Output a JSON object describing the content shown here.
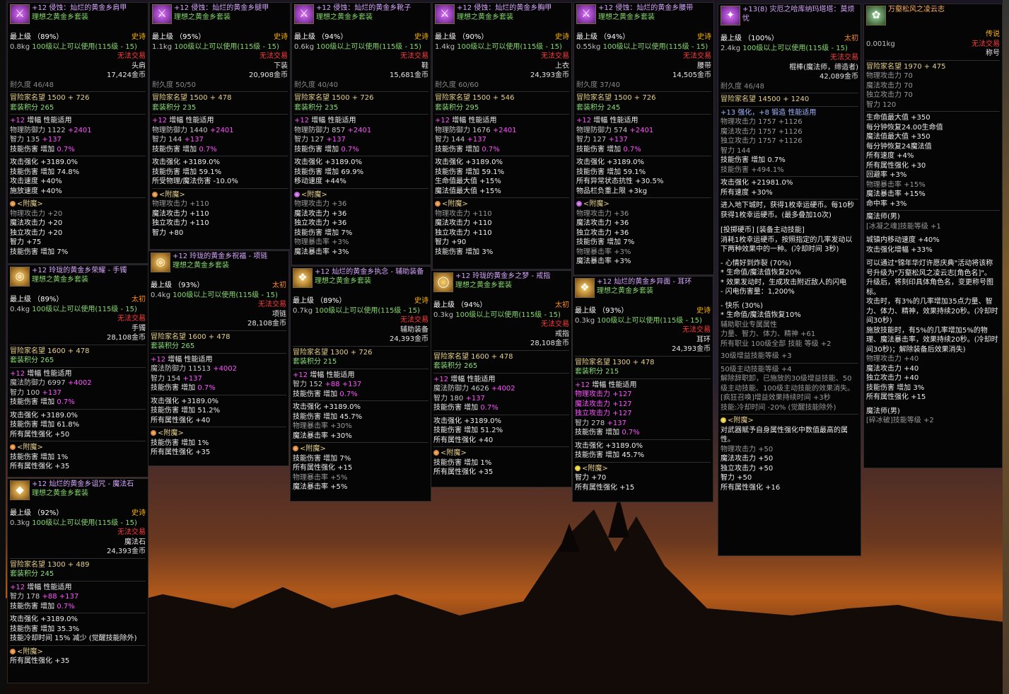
{
  "tooltips": [
    {
      "id": "shoulder",
      "title": "+12 侵蚀：灿烂的黄金乡肩甲",
      "set": "理想之黄金乡套装",
      "grade": "最上级 （89%）",
      "rarity": "史诗",
      "weight": "0.8kg",
      "level": "100级以上可以使用(115级 - 15)",
      "trade": "无法交易",
      "slot": "头肩",
      "price": "17,424金币",
      "durability": "耐久度 46/48",
      "renown": "冒险家名望 1500 + 726",
      "setpoints": "套装积分 265",
      "amp_line": "增幅 性能适用",
      "amp_prefix": "+12",
      "stats": [
        {
          "t": "物理防御力 1122",
          "b": "+2401"
        },
        {
          "t": "智力 135",
          "b": "+137"
        },
        {
          "t": "技能伤害 增加",
          "b": "0.7%"
        }
      ],
      "options": [
        "攻击强化 +3189.0%",
        "技能伤害 增加 74.8%",
        "攻击速度 +40%",
        "施放速度 +40%"
      ],
      "enchant_label": "<附魔>",
      "enchant_dim": "物理攻击力 +20",
      "enchant": [
        "魔法攻击力 +20",
        "独立攻击力 +20",
        "智力 +75",
        "技能伤害 增加 7%"
      ]
    },
    {
      "id": "pants",
      "title": "+12 侵蚀：灿烂的黄金乡腿甲",
      "set": "理想之黄金乡套装",
      "grade": "最上级 （95%）",
      "rarity": "史诗",
      "weight": "1.1kg",
      "level": "100级以上可以使用(115级 - 15)",
      "trade": "无法交易",
      "slot": "下装",
      "price": "20,908金币",
      "durability": "耐久度 50/50",
      "renown": "冒险家名望 1500 + 478",
      "setpoints": "套装积分 235",
      "amp_line": "增幅 性能适用",
      "amp_prefix": "+12",
      "stats": [
        {
          "t": "物理防御力 1440",
          "b": "+2401"
        },
        {
          "t": "智力 144",
          "b": "+137"
        },
        {
          "t": "技能伤害 增加",
          "b": "0.7%"
        }
      ],
      "options": [
        "攻击强化 +3189.0%",
        "技能伤害 增加 59.1%",
        "所受物理/魔法伤害 -10.0%"
      ],
      "enchant_label": "<附魔>",
      "enchant_dim": "物理攻击力 +110",
      "enchant": [
        "魔法攻击力 +110",
        "独立攻击力 +110",
        "智力 +80"
      ]
    },
    {
      "id": "shoes",
      "title": "+12 侵蚀：灿烂的黄金乡靴子",
      "set": "理想之黄金乡套装",
      "grade": "最上级 （94%）",
      "rarity": "史诗",
      "weight": "0.6kg",
      "level": "100级以上可以使用(115级 - 15)",
      "trade": "无法交易",
      "slot": "鞋",
      "price": "15,681金币",
      "durability": "耐久度 40/40",
      "renown": "冒险家名望 1500 + 726",
      "setpoints": "套装积分 235",
      "amp_line": "增幅 性能适用",
      "amp_prefix": "+12",
      "stats": [
        {
          "t": "物理防御力 857",
          "b": "+2401"
        },
        {
          "t": "智力 127",
          "b": "+137"
        },
        {
          "t": "技能伤害 增加",
          "b": "0.7%"
        }
      ],
      "options": [
        "攻击强化 +3189.0%",
        "技能伤害 增加 69.9%",
        "移动速度 +44%"
      ],
      "enchant_label": "<附魔>",
      "enchant_dim": "物理攻击力 +36",
      "enchant": [
        "魔法攻击力 +36",
        "独立攻击力 +36",
        "技能伤害 增加 7%"
      ],
      "enchant_dim2": "物理暴击率 +3%",
      "enchant2": [
        "魔法暴击率 +3%"
      ]
    },
    {
      "id": "chest",
      "title": "+12 侵蚀：灿烂的黄金乡胸甲",
      "set": "理想之黄金乡套装",
      "grade": "最上级 （90%）",
      "rarity": "史诗",
      "weight": "1.4kg",
      "level": "100级以上可以使用(115级 - 15)",
      "trade": "无法交易",
      "slot": "上衣",
      "price": "24,393金币",
      "durability": "耐久度 60/60",
      "renown": "冒险家名望 1500 + 546",
      "setpoints": "套装积分 295",
      "amp_line": "增幅 性能适用",
      "amp_prefix": "+12",
      "stats": [
        {
          "t": "物理防御力 1676",
          "b": "+2401"
        },
        {
          "t": "智力 144",
          "b": "+137"
        },
        {
          "t": "技能伤害 增加",
          "b": "0.7%"
        }
      ],
      "options": [
        "攻击强化 +3189.0%",
        "技能伤害 增加 59.1%",
        "生命值最大值 +15%",
        "魔法值最大值 +15%"
      ],
      "enchant_label": "<附魔>",
      "enchant_dim": "物理攻击力 +110",
      "enchant": [
        "魔法攻击力 +110",
        "独立攻击力 +110",
        "智力 +90",
        "技能伤害 增加 3%"
      ]
    },
    {
      "id": "belt",
      "title": "+12 侵蚀：灿烂的黄金乡腰带",
      "set": "理想之黄金乡套装",
      "grade": "最上级 （94%）",
      "rarity": "史诗",
      "weight": "0.55kg",
      "level": "100级以上可以使用(115级 - 15)",
      "trade": "无法交易",
      "slot": "腰带",
      "price": "14,505金币",
      "durability": "耐久度 37/40",
      "renown": "冒险家名望 1500 + 726",
      "setpoints": "套装积分 245",
      "amp_line": "增幅 性能适用",
      "amp_prefix": "+12",
      "stats": [
        {
          "t": "物理防御力 574",
          "b": "+2401"
        },
        {
          "t": "智力 127",
          "b": "+137"
        },
        {
          "t": "技能伤害 增加",
          "b": "0.7%"
        }
      ],
      "options": [
        "攻击强化 +3189.0%",
        "技能伤害 增加 59.1%",
        "所有异常状态抗性 +30.5%",
        "物品栏负重上限 +3kg"
      ],
      "enchant_label": "<附魔>",
      "enchant_dim": "物理攻击力 +36",
      "enchant": [
        "魔法攻击力 +36",
        "独立攻击力 +36",
        "技能伤害 增加 7%"
      ],
      "enchant_dim2": "物理暴击率 +3%",
      "enchant2": [
        "魔法暴击率 +3%"
      ]
    },
    {
      "id": "weapon",
      "title": "+13(8) 灾厄之哈库纳玛塔塔：莫烦忧",
      "grade": "最上级 （100%）",
      "rarity": "太初",
      "weight": "2.4kg",
      "level": "100级以上可以使用(115级 - 15)",
      "trade": "无法交易",
      "slot": "棍棒(魔法师，缔造者)",
      "price": "42,089金币",
      "durability": "耐久度 46/48",
      "renown": "冒险家名望 14500 + 1240",
      "refine": "+13 强化，+8 锻造 性能适用",
      "dim_stats": [
        "物理攻击力 1757 +1126",
        "魔法攻击力 1757 +1126",
        "独立攻击力 1757 +1126"
      ],
      "int_line": "智力 144",
      "skill1": "技能伤害 增加 0.7%",
      "skill2": "技能伤害 +494.1%",
      "opt1": "攻击强化 +21981.0%",
      "opt2": "所有速度 +30%",
      "desc1": "进入地下城时，获得1枚幸运硬币。每10秒获得1枚幸运硬币。(最多叠加10次)",
      "desc2": "[投掷硬币] [装备主动技能]",
      "desc3": "消耗1枚幸运硬币，按照指定的几率发动以下两种效果中的一种。(冷却时间 3秒)",
      "desc4": "- 心情好到炸裂 (70%)",
      "desc5": "* 生命值/魔法值恢复20%",
      "desc6": "* 效果发动时，生成攻击附近敌人的闪电",
      "desc7": "- 闪电伤害量：1,200%",
      "desc8": "- 快乐 (30%)",
      "desc9": "* 生命值/魔法值恢复10%",
      "desc10": "辅助职业专属属性",
      "desc11": "力量、智力、体力、精神 +61",
      "desc12": "所有职业 100级全部 技能 等级 +2",
      "desc13": "30级增益技能等级 +3",
      "desc14": "50级主动技能等级 +4",
      "desc15": "解除辞职卸，已施放的30级增益技能、50级主动技能、100级主动技能的效果消失。",
      "desc16": "[疯狂召唤]增益效果持续时间 +3秒",
      "desc17": "技能:冷却时间 -20% (觉醒技能除外)",
      "enchant_label": "<附魔>",
      "enchant_text": "对武器赋予自身属性强化中数值最高的属性。",
      "enchant_dim": "物理攻击力 +50",
      "enchant": [
        "魔法攻击力 +50",
        "独立攻击力 +50",
        "智力 +50",
        "所有属性强化 +16"
      ]
    },
    {
      "id": "title",
      "title": "万壑松风之凌云志",
      "rarity": "传说",
      "weight": "0.001kg",
      "trade": "无法交易",
      "slot": "称号",
      "renown": "冒险家名望 1970 + 475",
      "dim_stats": [
        "物理攻击力 70",
        "魔法攻击力 70",
        "独立攻击力 70",
        "智力 120"
      ],
      "effects": [
        "生命值最大值 +350",
        "每分钟恢复24.00生命值",
        "魔法值最大值 +350",
        "每分钟恢复24魔法值",
        "所有速度 +4%",
        "所有属性强化 +30",
        "回避率 +3%"
      ],
      "dim2": "物理暴击率 +15%",
      "effects2": [
        "魔法暴击率 +15%",
        "命中率 +3%"
      ],
      "class1": "魔法师(男)",
      "class1_skill": "[冰凝之魂]技能等级 +1",
      "town": "城镇内移动速度 +40%",
      "atk": "攻击强化增幅 +33%",
      "desc": "可以通过\"锦年华灯许愿庆典\"活动将该称号升级为\"万壑松风之凌云志[角色名]\"。",
      "desc2": "升级后，将刻印具体角色名，变更称号图标。",
      "desc3": "攻击时，有3%的几率增加35点力量、智力、体力、精神，效果持续20秒。(冷却时间30秒)",
      "desc4": "施放技能时，有5%的几率增加5%的物理、魔法暴击率，效果持续20秒。(冷却时间30秒)；解除装备后效果消失)",
      "dim3": "物理攻击力 +40",
      "eff3": [
        "魔法攻击力 +40",
        "独立攻击力 +40",
        "技能伤害 增加 3%",
        "所有属性强化 +15"
      ],
      "class2": "魔法师(男)",
      "class2_skill": "[碎冰破]技能等级 +2"
    },
    {
      "id": "bracelet",
      "title": "+12 玲珑的黄金乡荣耀 - 手镯",
      "set": "理想之黄金乡套装",
      "grade": "最上级 （89%）",
      "rarity": "太初",
      "weight": "0.4kg",
      "level": "100级以上可以使用(115级 - 15)",
      "trade": "无法交易",
      "slot": "手镯",
      "price": "28,108金币",
      "renown": "冒险家名望 1600 + 478",
      "setpoints": "套装积分 265",
      "amp_line": "增幅 性能适用",
      "amp_prefix": "+12",
      "stats": [
        {
          "t": "魔法防御力 6997",
          "b": "+4002"
        },
        {
          "t": "智力 100",
          "b": "+137"
        },
        {
          "t": "技能伤害 增加",
          "b": "0.7%"
        }
      ],
      "options": [
        "攻击强化 +3189.0%",
        "技能伤害 增加 61.8%",
        "所有属性强化 +50"
      ],
      "enchant_label": "<附魔>",
      "enchant": [
        "技能伤害 增加 1%",
        "所有属性强化 +35"
      ]
    },
    {
      "id": "necklace",
      "title": "+12 玲珑的黄金乡祝福 - 项链",
      "set": "理想之黄金乡套装",
      "grade": "最上级 （93%）",
      "rarity": "太初",
      "weight": "0.4kg",
      "level": "100级以上可以使用(115级 - 15)",
      "trade": "无法交易",
      "slot": "项链",
      "price": "28,108金币",
      "renown": "冒险家名望 1600 + 478",
      "setpoints": "套装积分 265",
      "amp_line": "增幅 性能适用",
      "amp_prefix": "+12",
      "stats": [
        {
          "t": "魔法防御力 11513",
          "b": "+4002"
        },
        {
          "t": "智力 154",
          "b": "+137"
        },
        {
          "t": "技能伤害 增加",
          "b": "0.7%"
        }
      ],
      "options": [
        "攻击强化 +3189.0%",
        "技能伤害 增加 51.2%",
        "所有属性强化 +40"
      ],
      "enchant_label": "<附魔>",
      "enchant": [
        "技能伤害 增加 1%",
        "所有属性强化 +35"
      ]
    },
    {
      "id": "aux",
      "title": "+12 灿烂的黄金乡执念 - 辅助装备",
      "set": "理想之黄金乡套装",
      "grade": "最上级 （89%）",
      "rarity": "史诗",
      "weight": "0.7kg",
      "level": "100级以上可以使用(115级 - 15)",
      "trade": "无法交易",
      "slot": "辅助装备",
      "price": "24,393金币",
      "renown": "冒险家名望 1300 + 726",
      "setpoints": "套装积分 215",
      "amp_line": "增幅 性能适用",
      "amp_prefix": "+12",
      "stats": [
        {
          "t": "智力 152",
          "b": "+88 +137"
        },
        {
          "t": "技能伤害 增加",
          "b": "0.7%"
        }
      ],
      "options": [
        "攻击强化 +3189.0%",
        "技能伤害 增加 45.7%"
      ],
      "opt_dim": "物理暴击率 +30%",
      "options2": [
        "魔法暴击率 +30%"
      ],
      "enchant_label": "<附魔>",
      "enchant": [
        "技能伤害 增加 7%",
        "所有属性强化 +15"
      ],
      "enchant_dim": "物理暴击率 +5%",
      "enchant2": [
        "魔法暴击率 +5%"
      ]
    },
    {
      "id": "ring",
      "title": "+12 玲珑的黄金乡之梦 - 戒指",
      "set": "理想之黄金乡套装",
      "grade": "最上级 （94%）",
      "rarity": "太初",
      "weight": "0.3kg",
      "level": "100级以上可以使用(115级 - 15)",
      "trade": "无法交易",
      "slot": "戒指",
      "price": "28,108金币",
      "renown": "冒险家名望 1600 + 478",
      "setpoints": "套装积分 265",
      "amp_line": "增幅 性能适用",
      "amp_prefix": "+12",
      "stats": [
        {
          "t": "魔法防御力 4626",
          "b": "+4002"
        },
        {
          "t": "智力 180",
          "b": "+137"
        },
        {
          "t": "技能伤害 增加",
          "b": "0.7%"
        }
      ],
      "options": [
        "攻击强化 +3189.0%",
        "技能伤害 增加 51.2%",
        "所有属性强化 +40"
      ],
      "enchant_label": "<附魔>",
      "enchant": [
        "技能伤害 增加 1%",
        "所有属性强化 +35"
      ]
    },
    {
      "id": "earring",
      "title": "+12 灿烂的黄金乡异面 - 耳环",
      "set": "理想之黄金乡套装",
      "grade": "最上级 （93%）",
      "rarity": "史诗",
      "weight": "0.3kg",
      "level": "100级以上可以使用(115级 - 15)",
      "trade": "无法交易",
      "slot": "耳环",
      "price": "24,393金币",
      "renown": "冒险家名望 1300 + 478",
      "setpoints": "套装积分 215",
      "amp_line": "增幅 性能适用",
      "amp_prefix": "+12",
      "stats": [
        {
          "t": "物理攻击力",
          "b": "+127"
        },
        {
          "t": "魔法攻击力",
          "b": "+127"
        },
        {
          "t": "独立攻击力",
          "b": "+127"
        },
        {
          "t": "智力 278",
          "b": "+137"
        },
        {
          "t": "技能伤害 增加",
          "b": "0.7%"
        }
      ],
      "options": [
        "攻击强化 +3189.0%",
        "技能伤害 增加 45.7%"
      ],
      "enchant_label": "<附魔>",
      "enchant": [
        "智力 +70",
        "所有属性强化 +15"
      ]
    },
    {
      "id": "stone",
      "title": "+12 灿烂的黄金乡诅咒 - 魔法石",
      "set": "理想之黄金乡套装",
      "grade": "最上级 （92%）",
      "rarity": "史诗",
      "weight": "0.3kg",
      "level": "100级以上可以使用(115级 - 15)",
      "trade": "无法交易",
      "slot": "魔法石",
      "price": "24,393金币",
      "renown": "冒险家名望 1300 + 489",
      "setpoints": "套装积分 245",
      "amp_line": "增幅 性能适用",
      "amp_prefix": "+12",
      "stats": [
        {
          "t": "智力 178",
          "b": "+88 +137"
        },
        {
          "t": "技能伤害 增加",
          "b": "0.7%"
        }
      ],
      "options": [
        "攻击强化 +3189.0%",
        "技能伤害 增加 35.3%",
        "技能冷却时间 15% 减少 (觉醒技能除外)"
      ],
      "enchant_label": "<附魔>",
      "enchant": [
        "所有属性强化 +35"
      ]
    }
  ],
  "colors": {
    "epic": "#ffb400",
    "primeval": "#ff8a1c",
    "amp": "#ff52ff",
    "set": "#86d86c",
    "trade_warning": "#ff3a3a"
  }
}
